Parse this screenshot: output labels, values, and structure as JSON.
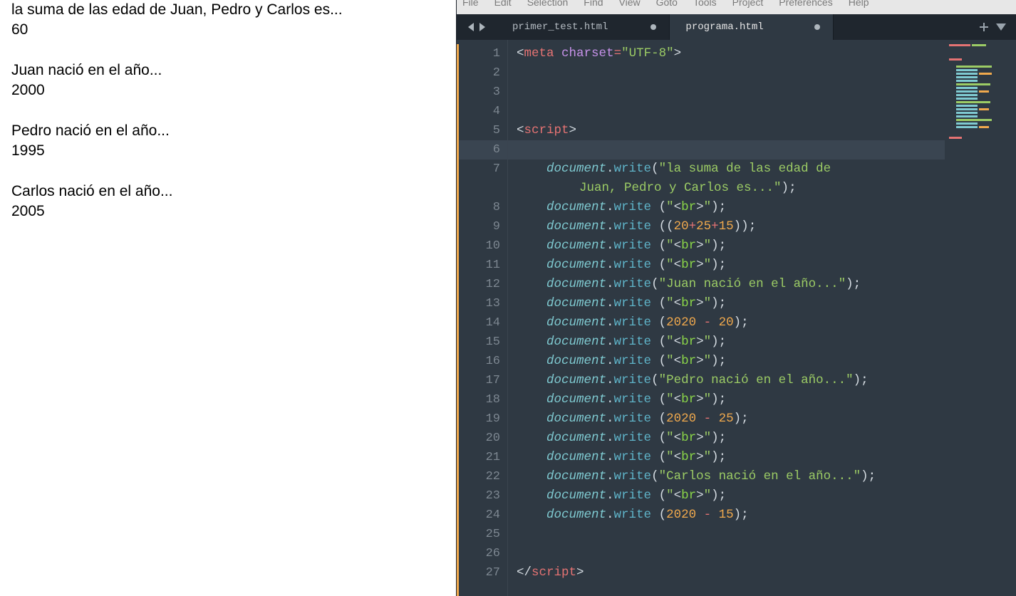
{
  "browser": {
    "line1": "la suma de las edad de Juan, Pedro y Carlos es...",
    "line2": "60",
    "line3": "Juan nació en el año...",
    "line4": "2000",
    "line5": "Pedro nació en el año...",
    "line6": "1995",
    "line7": "Carlos nació en el año...",
    "line8": "2005"
  },
  "menu": {
    "file": "File",
    "edit": "Edit",
    "selection": "Selection",
    "find": "Find",
    "view": "View",
    "goto": "Goto",
    "tools": "Tools",
    "project": "Project",
    "preferences": "Preferences",
    "help": "Help"
  },
  "tabs": {
    "t1": "primer_test.html",
    "t2": "programa.html"
  },
  "code": {
    "lineNumbers": [
      "1",
      "2",
      "3",
      "4",
      "5",
      "6",
      "7",
      "8",
      "9",
      "10",
      "11",
      "12",
      "13",
      "14",
      "15",
      "16",
      "17",
      "18",
      "19",
      "20",
      "21",
      "22",
      "23",
      "24",
      "25",
      "26",
      "27"
    ],
    "meta_open": "<",
    "meta_tag": "meta",
    "meta_sp": " ",
    "meta_attr": "charset",
    "meta_eq": "=",
    "meta_val": "\"UTF-8\"",
    "meta_close": ">",
    "script_open_lt": "<",
    "script_tag": "script",
    "script_open_gt": ">",
    "script_close_lt": "</",
    "script_close_gt": ">",
    "doc": "document",
    "dot": ".",
    "write": "write",
    "lpar": "(",
    "rpar": ")",
    "lpar_sp": " (",
    "semi": ";",
    "br_open_q": "\"",
    "br_lt": "<",
    "br_name": "br",
    "br_gt": ">",
    "br_close_q": "\"",
    "s_sum1": "\"la suma de las edad de ",
    "s_sum2": "Juan, Pedro y Carlos es...\"",
    "n20": "20",
    "n25": "25",
    "n15": "15",
    "n2020": "2020",
    "plus": "+",
    "minus": " - ",
    "s_juan": "\"Juan nació en el año...\"",
    "s_pedro": "\"Pedro nació en el año...\"",
    "s_carlos": "\"Carlos nació en el año...\"",
    "dlpar": "((",
    "drpar": "))"
  }
}
